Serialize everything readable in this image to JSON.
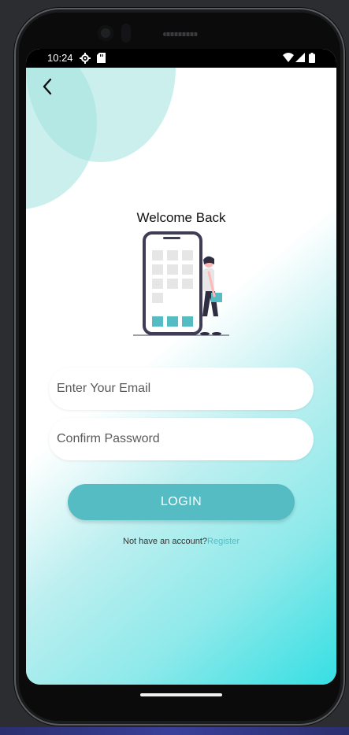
{
  "status_bar": {
    "time": "10:24"
  },
  "header": {
    "title": "Welcome Back"
  },
  "form": {
    "email_placeholder": "Enter Your Email",
    "email_value": "",
    "password_placeholder": "Confirm Password",
    "password_value": "",
    "login_label": "LOGIN"
  },
  "footer": {
    "prompt": "Not have an account?",
    "register_label": "Register"
  },
  "colors": {
    "accent": "#55bcc4",
    "gradient_end": "#35dfe3",
    "blob": "#a0e1de"
  },
  "icons": [
    "back-arrow-icon",
    "settings-icon",
    "sd-card-icon",
    "wifi-icon",
    "signal-icon",
    "battery-icon"
  ]
}
